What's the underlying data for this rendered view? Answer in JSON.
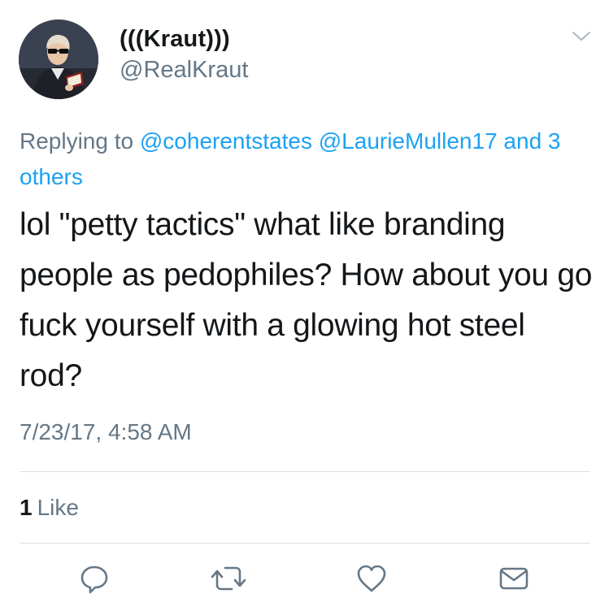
{
  "user": {
    "display_name": "(((Kraut)))",
    "handle": "@RealKraut"
  },
  "reply": {
    "prefix": "Replying to",
    "mentions": [
      "@coherentstates",
      "@LaurieMullen17"
    ],
    "others": "and 3 others"
  },
  "tweet": {
    "text": "lol \"petty tactics\" what like branding people as pedophiles? How about you go fuck yourself with a glowing hot steel rod?",
    "timestamp": "7/23/17, 4:58 AM"
  },
  "stats": {
    "likes_count": "1",
    "likes_label": "Like"
  },
  "actions": {
    "reply_icon": "reply-icon",
    "retweet_icon": "retweet-icon",
    "like_icon": "heart-icon",
    "dm_icon": "envelope-icon"
  },
  "colors": {
    "link": "#1da1f2",
    "secondary_text": "#657786",
    "primary_text": "#14171a",
    "divider": "#d8dee4"
  }
}
